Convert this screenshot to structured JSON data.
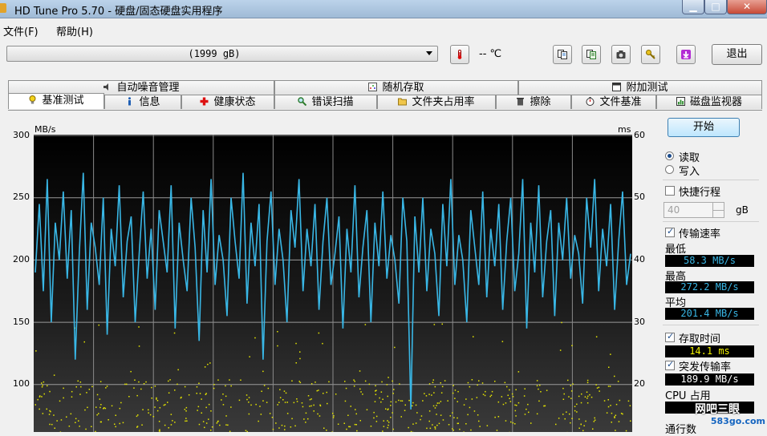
{
  "window": {
    "title": "HD Tune Pro 5.70 - 硬盘/固态硬盘实用程序"
  },
  "menu": {
    "items": [
      "文件(F)",
      "帮助(H)"
    ]
  },
  "toolbar": {
    "drive": "(1999 gB)",
    "temperature": "-- ℃",
    "exit_label": "退出",
    "buttons": [
      "copy-icon",
      "copy-text-icon",
      "camera-icon",
      "key-icon",
      "save-icon"
    ]
  },
  "tabs": {
    "top_row": [
      "自动噪音管理",
      "随机存取",
      "附加测试"
    ],
    "bottom_row": [
      "基准测试",
      "信息",
      "健康状态",
      "错误扫描",
      "文件夹占用率",
      "擦除",
      "文件基准",
      "磁盘监视器"
    ],
    "active": "基准测试"
  },
  "chart_data": {
    "type": "line",
    "ylabel_left": "MB/s",
    "ylabel_right": "ms",
    "y_ticks_left": [
      "300",
      "250",
      "200",
      "150",
      "100"
    ],
    "y_ticks_right": [
      "60",
      "50",
      "40",
      "30",
      "20"
    ],
    "ylim": [
      0,
      300
    ],
    "ylim_right": [
      0,
      60
    ],
    "grid": true,
    "series": [
      {
        "values": [
          190,
          245,
          175,
          265,
          150,
          230,
          200,
          255,
          185,
          240,
          120,
          205,
          270,
          160,
          230,
          210,
          180,
          250,
          140,
          225,
          195,
          260,
          170,
          215,
          235,
          150,
          205,
          255,
          185,
          225,
          160,
          240,
          215,
          190,
          260,
          145,
          230,
          200,
          175,
          250,
          210,
          135,
          240,
          190,
          265,
          180,
          220,
          200,
          155,
          250,
          215,
          185,
          270,
          165,
          230,
          195,
          245,
          120,
          215,
          255,
          180,
          225,
          200,
          150,
          240,
          210,
          265,
          175,
          225,
          195,
          245,
          160,
          215,
          250,
          180,
          205,
          235,
          145,
          225,
          190,
          260,
          170,
          210,
          240,
          150,
          230,
          195,
          255,
          185,
          220,
          200,
          165,
          250,
          215,
          80,
          235,
          190,
          250,
          175,
          225,
          205,
          155,
          245,
          195,
          265,
          180,
          220,
          200,
          150,
          240,
          210,
          180,
          255,
          170,
          225,
          195,
          245,
          160,
          215,
          250,
          175,
          205,
          265,
          145,
          230,
          190,
          260,
          170,
          215,
          240,
          155,
          230,
          200,
          250,
          185,
          220,
          205,
          165,
          250,
          210,
          265,
          175,
          225,
          195,
          245,
          160,
          215,
          255,
          180,
          205
        ]
      },
      {
        "values": []
      }
    ]
  },
  "panel": {
    "start_label": "开始",
    "radio_read": "读取",
    "radio_write": "写入",
    "short_stroke_label": "快捷行程",
    "short_stroke_value": "40",
    "short_stroke_unit": "gB",
    "transfer_rate_label": "传输速率",
    "min_label": "最低",
    "min_value": "58.3 MB/s",
    "max_label": "最高",
    "max_value": "272.2 MB/s",
    "avg_label": "平均",
    "avg_value": "201.4 MB/s",
    "access_time_label": "存取时间",
    "access_time_value": "14.1 ms",
    "burst_label": "突发传输率",
    "burst_value": "189.9 MB/s",
    "cpu_label": "CPU 占用",
    "passes_label": "通行数",
    "readout_colors": {
      "speed": "#39b7e6",
      "access": "#f2f200",
      "burst": "#ffffff"
    }
  },
  "watermark": {
    "text": "网吧三眼",
    "site": "583go.com"
  }
}
